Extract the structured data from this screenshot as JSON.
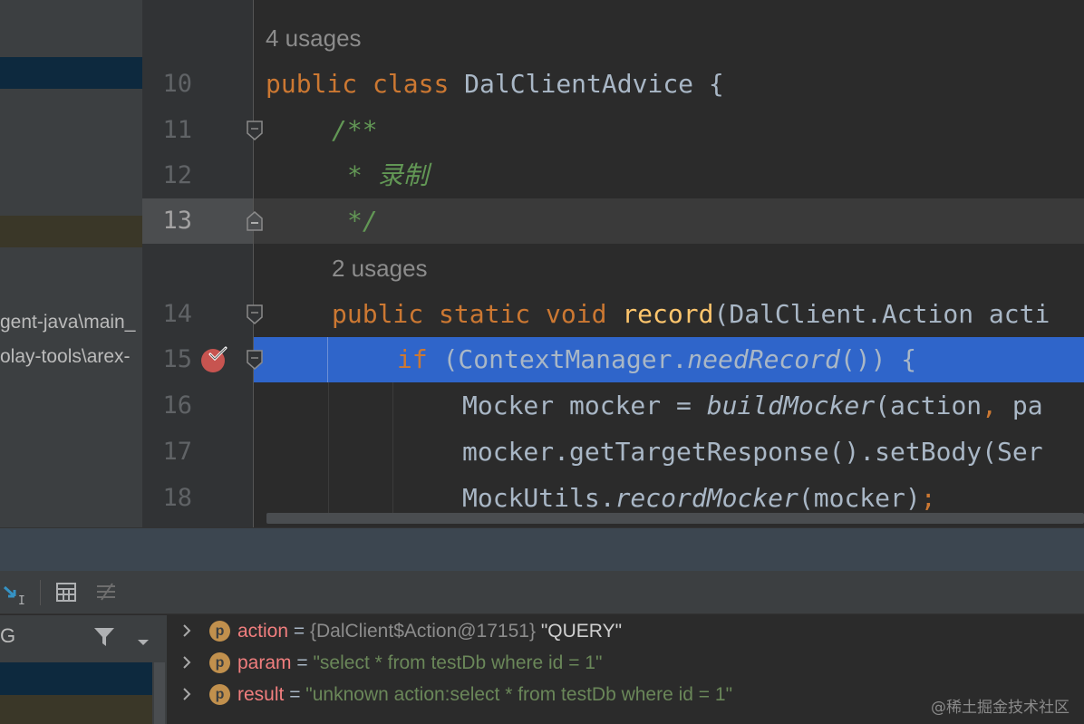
{
  "project_panel": {
    "path_line_1": "gent-java\\main_",
    "path_line_2": "olay-tools\\arex-"
  },
  "editor": {
    "usage_hints": {
      "class_usages": "4 usages",
      "method_usages": "2 usages"
    },
    "lines": {
      "10": "10",
      "11": "11",
      "12": "12",
      "13": "13",
      "14": "14",
      "15": "15",
      "16": "16",
      "17": "17",
      "18": "18"
    },
    "code": {
      "l10_kw1": "public",
      "l10_kw2": "class",
      "l10_name": "DalClientAdvice",
      "l10_brace": "{",
      "l11": "/**",
      "l12": "* 录制",
      "l13": "*/",
      "l14_kw1": "public",
      "l14_kw2": "static",
      "l14_kw3": "void",
      "l14_method": "record",
      "l14_rest": "(DalClient.Action acti",
      "l15_kw": "if",
      "l15_a": "(ContextManager.",
      "l15_method": "needRecord",
      "l15_b": "()) {",
      "l16_a": "Mocker mocker = ",
      "l16_method": "buildMocker",
      "l16_b": "(action",
      "l16_comma": ",",
      "l16_c": " pa",
      "l17": "mocker.getTargetResponse().setBody(Ser",
      "l18_a": "MockUtils.",
      "l18_method": "recordMocker",
      "l18_b": "(mocker)",
      "l18_semi": ";"
    }
  },
  "frames_panel": {
    "group_label": "G"
  },
  "variables": [
    {
      "badge": "p",
      "name": "action",
      "eq": " = ",
      "obj": "{DalClient$Action@17151}",
      "value": " \"QUERY\""
    },
    {
      "badge": "p",
      "name": "param",
      "eq": " = ",
      "value": "\"select * from testDb where id = 1\""
    },
    {
      "badge": "p",
      "name": "result",
      "eq": " = ",
      "value": "\"unknown action:select * from testDb where id = 1\""
    }
  ],
  "watermark": "@稀土掘金技术社区",
  "icons": [
    "step-into-icon",
    "evaluate-table-icon",
    "settings-list-icon",
    "filter-icon",
    "dropdown-arrow-icon",
    "breakpoint-icon",
    "fold-icon",
    "expand-chevron-icon"
  ],
  "colors": {
    "keyword": "#cc7832",
    "method": "#ffc66d",
    "comment": "#629755",
    "string": "#6a8759",
    "execution_line": "#2f65ca",
    "breakpoint": "#c75450"
  }
}
